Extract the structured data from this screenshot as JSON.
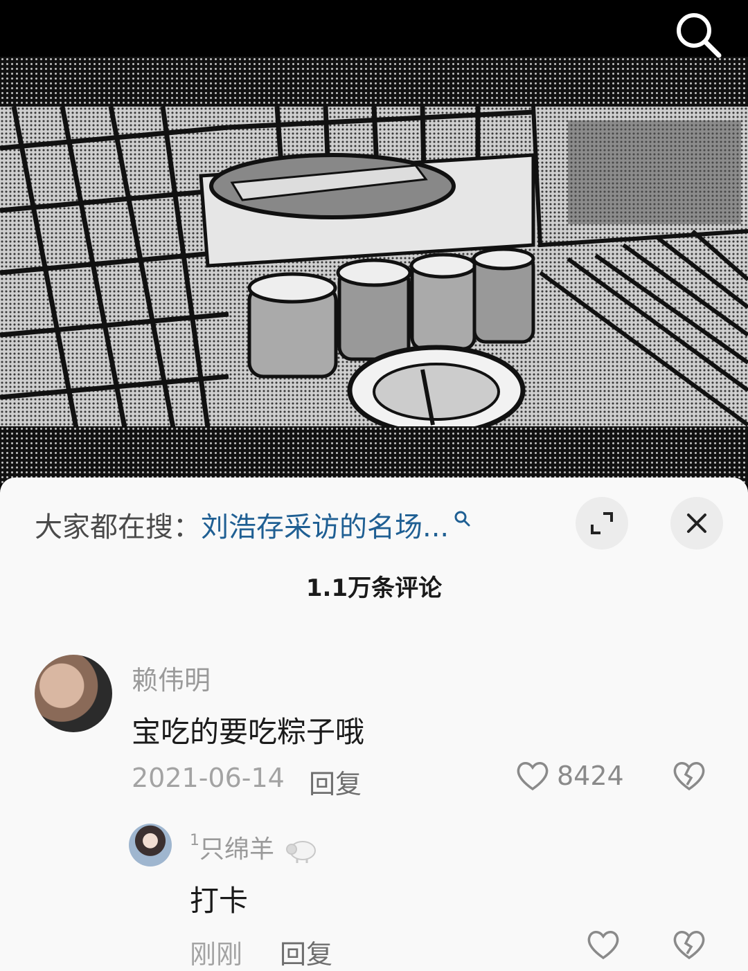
{
  "video": {
    "search_icon": "search-icon"
  },
  "sheet": {
    "hot_search_prefix": "大家都在搜：",
    "hot_search_term": "刘浩存采访的名场...",
    "comment_count_title": "1.1万条评论",
    "icons": [
      "expand-icon",
      "close-icon",
      "small-search-icon"
    ]
  },
  "comments": [
    {
      "username": "赖伟明",
      "text": "宝吃的要吃粽子哦",
      "date": "2021-06-14",
      "reply_label": "回复",
      "likes": "8424"
    },
    {
      "username_sup": "1",
      "username": "只绵羊",
      "text": "打卡",
      "date": "刚刚",
      "reply_label": "回复",
      "likes": ""
    }
  ],
  "colors": {
    "link": "#1f5f93",
    "sheet_bg": "#f9f9f9",
    "muted": "#9a9a9a"
  }
}
